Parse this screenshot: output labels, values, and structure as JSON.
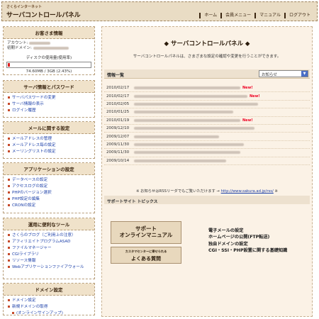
{
  "header": {
    "logo_sub": "さくらインターネット",
    "logo_main": "サーバコントロールパネル",
    "nav": [
      "ホーム",
      "会員メニュー",
      "マニュアル",
      "ログアウト"
    ]
  },
  "account": {
    "title": "お客さま情報",
    "account_label": "アカウント:",
    "domain_label": "初期ドメイン:",
    "disk_label": "ディスクの使用量(使用率)",
    "disk_value": "74.60MB / 3GB (2.43%)",
    "disk_usage_fraction": 0.0243
  },
  "sections": [
    {
      "title": "サーバ情報とパスワード",
      "items": [
        "サーバパスワードの変更",
        "サーバ情報の表示",
        "ログイン履歴"
      ]
    },
    {
      "title": "メールに関する設定",
      "items": [
        "メールアドレスの管理",
        "メールアドレス毎の設定",
        "メーリングリストの設定"
      ]
    },
    {
      "title": "アプリケーションの設定",
      "items": [
        "データベースの設定",
        "アクセスログの設定",
        "PHPのバージョン選択",
        "PHP設定の編集",
        "CRONの設定"
      ]
    },
    {
      "title": "運用に便利なツール",
      "items": [
        "さくらのブログ（ご利用上の注意）",
        "アフィリエイトプログラムASAD",
        "ファイルマネージャー",
        "CGIライブラリ",
        "リソース情報",
        "Webアプリケーションファイアウォール"
      ]
    },
    {
      "title": "ドメイン設定",
      "items": [
        "ドメイン設定",
        "新規ドメインの取得",
        "(オンラインサインアップ)"
      ]
    }
  ],
  "main": {
    "title": "◆ サーバコントロールパネル ◆",
    "desc": "サーバコントロールパネルは、さまざまな設定の確認や変更を行うことができます。",
    "info_label": "情報一覧",
    "select_value": "お知らせ",
    "news": [
      {
        "date": "2010/02/17",
        "new": "New!"
      },
      {
        "date": "2010/02/17",
        "new": "New!"
      },
      {
        "date": "2010/02/05",
        "new": ""
      },
      {
        "date": "2010/01/25",
        "new": ""
      },
      {
        "date": "2010/01/19",
        "new": "New!"
      },
      {
        "date": "2009/12/10",
        "new": ""
      },
      {
        "date": "2009/12/07",
        "new": ""
      },
      {
        "date": "2009/11/30",
        "new": ""
      },
      {
        "date": "2009/11/30",
        "new": ""
      },
      {
        "date": "2009/10/14",
        "new": ""
      }
    ],
    "rss_text": "※ お知らせはRSSリーダでもご覧いただけます →",
    "rss_link": "http://www.sakura.ad.jp/rss/",
    "rss_tail": "※",
    "support_label": "サポートサイト トピックス",
    "manual_btn_line1": "サポート",
    "manual_btn_line2": "オンラインマニュアル",
    "faq_btn_small": "カスタマセンターに寄せられる",
    "faq_btn_large": "よくある質問",
    "topics": [
      "電子メールの設定",
      "ホームページの公開(FTP転送)",
      "独自ドメインの設定",
      "CGI・SSI・PHP設置に関する基礎知識"
    ]
  }
}
